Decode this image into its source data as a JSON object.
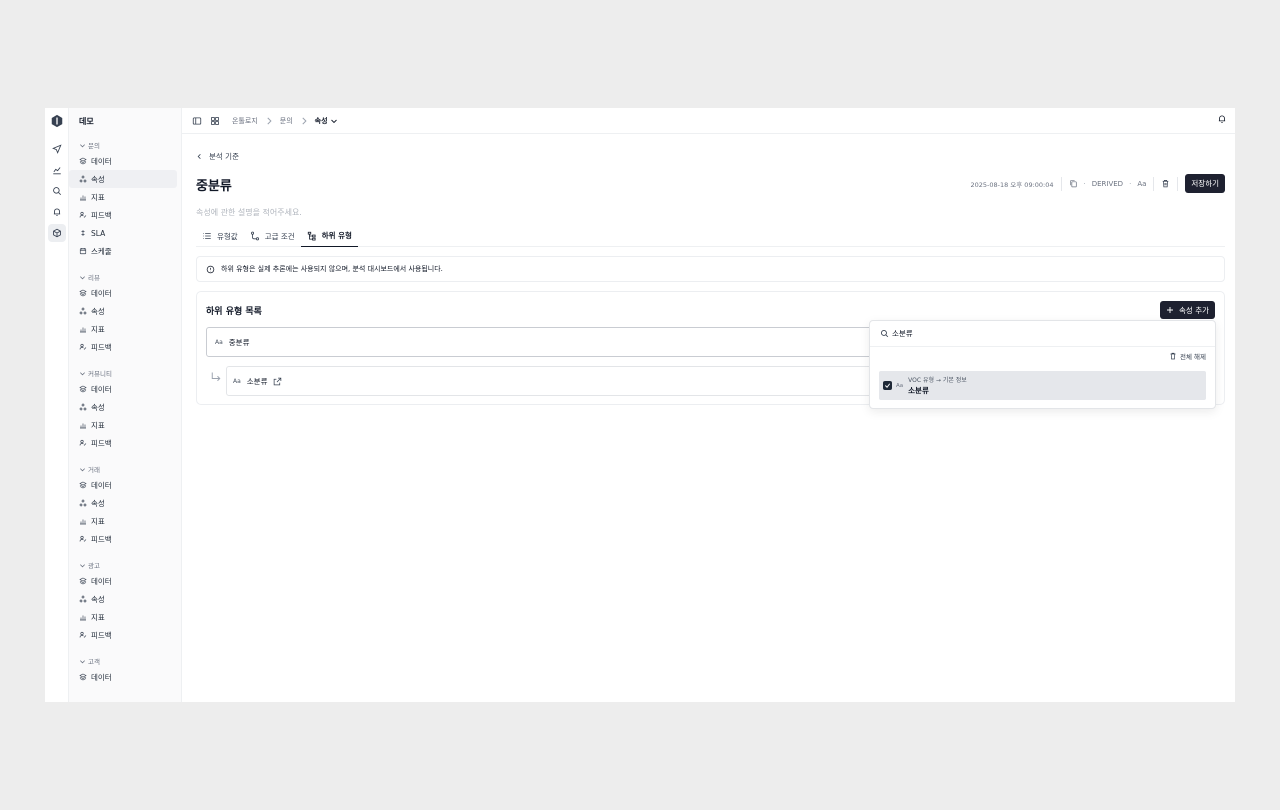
{
  "workspace": "데모",
  "sidebar": {
    "groups": [
      {
        "title": "문의",
        "items": [
          {
            "label": "데이터",
            "icon": "layers-icon"
          },
          {
            "label": "속성",
            "icon": "attribute-icon"
          },
          {
            "label": "지표",
            "icon": "metric-icon"
          },
          {
            "label": "피드백",
            "icon": "feedback-icon"
          },
          {
            "label": "SLA",
            "icon": "sla-icon"
          },
          {
            "label": "스케줄",
            "icon": "calendar-icon"
          }
        ]
      },
      {
        "title": "리뷰",
        "items": [
          {
            "label": "데이터"
          },
          {
            "label": "속성"
          },
          {
            "label": "지표"
          },
          {
            "label": "피드백"
          }
        ]
      },
      {
        "title": "커뮤니티",
        "items": [
          {
            "label": "데이터"
          },
          {
            "label": "속성"
          },
          {
            "label": "지표"
          },
          {
            "label": "피드백"
          }
        ]
      },
      {
        "title": "거래",
        "items": [
          {
            "label": "데이터"
          },
          {
            "label": "속성"
          },
          {
            "label": "지표"
          },
          {
            "label": "피드백"
          }
        ]
      },
      {
        "title": "광고",
        "items": [
          {
            "label": "데이터"
          },
          {
            "label": "속성"
          },
          {
            "label": "지표"
          },
          {
            "label": "피드백"
          }
        ]
      },
      {
        "title": "고객",
        "items": [
          {
            "label": "데이터"
          }
        ]
      }
    ]
  },
  "breadcrumb": {
    "items": [
      "온톨로지",
      "문의"
    ],
    "current": "속성"
  },
  "back_label": "분석 기준",
  "page_title": "중분류",
  "meta": {
    "timestamp": "2025-08-18 오후 09:00:04",
    "kind": "DERIVED",
    "type_label": "Aa",
    "save_label": "저장하기"
  },
  "description_placeholder": "속성에 관한 설명을 적어주세요.",
  "tabs": [
    {
      "label": "유형값"
    },
    {
      "label": "고급 조건"
    },
    {
      "label": "하위 유형"
    }
  ],
  "notice": "하위 유형은 실제 추론에는 사용되지 않으며, 분석 대시보드에서 사용됩니다.",
  "subtypes": {
    "title": "하위 유형 목록",
    "add_label": "속성 추가",
    "type_glyph": "Aa",
    "parent": "중분류",
    "child": "소분류"
  },
  "dropdown": {
    "search_value": "소분류",
    "clear_label": "전체 해제",
    "item_path": "VOC 유형 → 기본 정보",
    "item_name": "소분류"
  }
}
